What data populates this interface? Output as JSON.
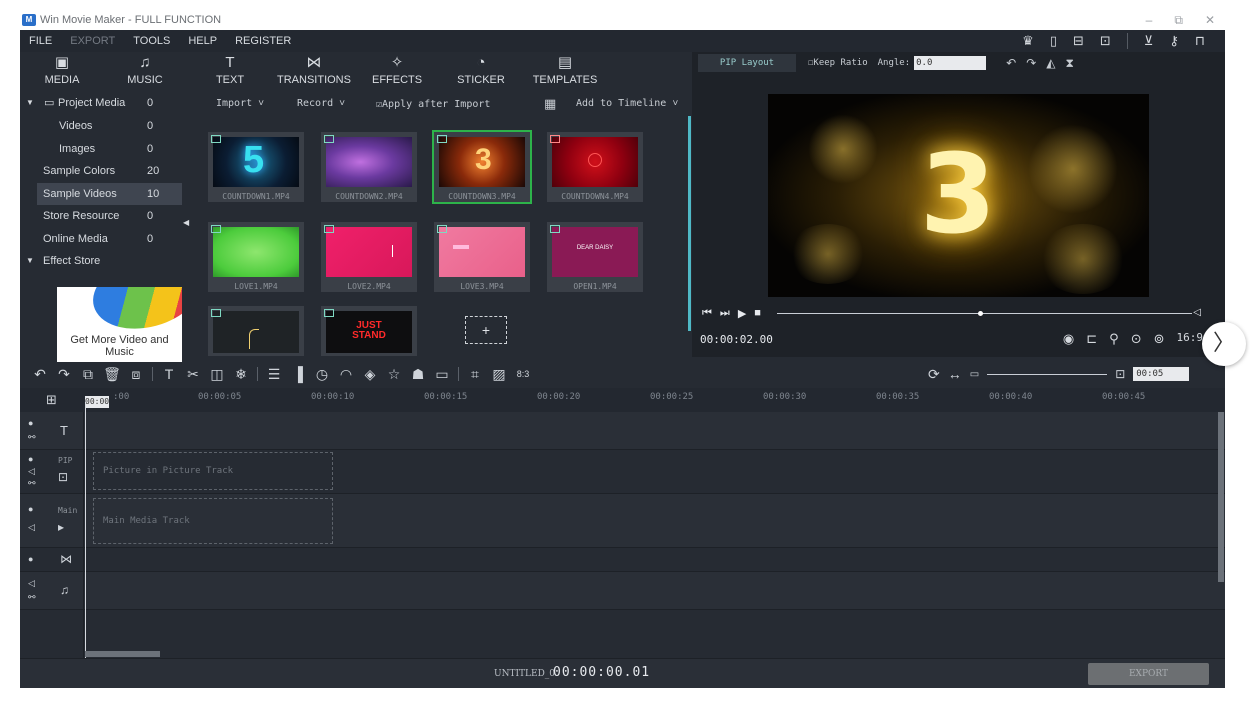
{
  "window": {
    "title": "Win Movie Maker - FULL FUNCTION",
    "controls": [
      "–",
      "⧉",
      "✕"
    ]
  },
  "menu": [
    {
      "label": "FILE",
      "enabled": true
    },
    {
      "label": "EXPORT",
      "enabled": false
    },
    {
      "label": "TOOLS",
      "enabled": true
    },
    {
      "label": "HELP",
      "enabled": true
    },
    {
      "label": "REGISTER",
      "enabled": true
    }
  ],
  "tabs": [
    {
      "label": "MEDIA",
      "icon": "▣"
    },
    {
      "label": "MUSIC",
      "icon": "♫"
    },
    {
      "label": "TEXT",
      "icon": "T"
    },
    {
      "label": "TRANSITIONS",
      "icon": "⋈"
    },
    {
      "label": "EFFECTS",
      "icon": "✧"
    },
    {
      "label": "STICKER",
      "icon": "◔"
    },
    {
      "label": "TEMPLATES",
      "icon": "▤"
    }
  ],
  "sidebar": {
    "items": [
      {
        "label": "Project Media",
        "count": "0"
      },
      {
        "label": "Videos",
        "count": "0"
      },
      {
        "label": "Images",
        "count": "0"
      },
      {
        "label": "Sample Colors",
        "count": "20"
      },
      {
        "label": "Sample Videos",
        "count": "10",
        "selected": true
      },
      {
        "label": "Store Resource",
        "count": "0"
      },
      {
        "label": "Online Media",
        "count": "0"
      },
      {
        "label": "Effect Store",
        "count": ""
      }
    ],
    "promo": "Get More Video and Music"
  },
  "media_toolbar": {
    "import": "Import",
    "record": "Record",
    "apply_after_import": "Apply after Import",
    "add_to_timeline": "Add to Timeline"
  },
  "clips": [
    {
      "name": "COUNTDOWN1.MP4"
    },
    {
      "name": "COUNTDOWN2.MP4"
    },
    {
      "name": "COUNTDOWN3.MP4",
      "selected": true
    },
    {
      "name": "COUNTDOWN4.MP4"
    },
    {
      "name": "LOVE1.MP4"
    },
    {
      "name": "LOVE2.MP4"
    },
    {
      "name": "LOVE3.MP4"
    },
    {
      "name": "OPEN1.MP4",
      "overlay": "DEAR DAISY"
    },
    {
      "name": ""
    },
    {
      "name": "",
      "overlay": "JUST STAND"
    }
  ],
  "preview": {
    "pip_layout": "PIP Layout",
    "keep_ratio": "Keep Ratio",
    "angle_label": "Angle:",
    "angle_value": "0.0",
    "screen_number": "3",
    "timecode": "00:00:02.00",
    "aspect": "16:9",
    "progress": 0.49
  },
  "timeline": {
    "ruler_ticks": [
      "00:00",
      "00:00:05",
      "00:00:10",
      "00:00:15",
      "00:00:20",
      "00:00:25",
      "00:00:30",
      "00:00:35",
      "00:00:40",
      "00:00:45"
    ],
    "start_label": "00:00",
    "zoom_value": "00:05",
    "tracks": [
      {
        "name": "",
        "icon": "T"
      },
      {
        "name": "PIP",
        "drop_text": "Picture in Picture Track"
      },
      {
        "name": "Main",
        "drop_text": "Main Media Track"
      },
      {
        "name": "",
        "icon": "⋈"
      },
      {
        "name": "",
        "icon": "♫"
      }
    ]
  },
  "status": {
    "project": "UNTITLED_0",
    "timecode": "00:00:00.01",
    "export_label": "EXPORT"
  },
  "colors": {
    "bg": "#262b33",
    "selected_clip": "#2db34a",
    "accent_scroll": "#4fb9c6"
  }
}
